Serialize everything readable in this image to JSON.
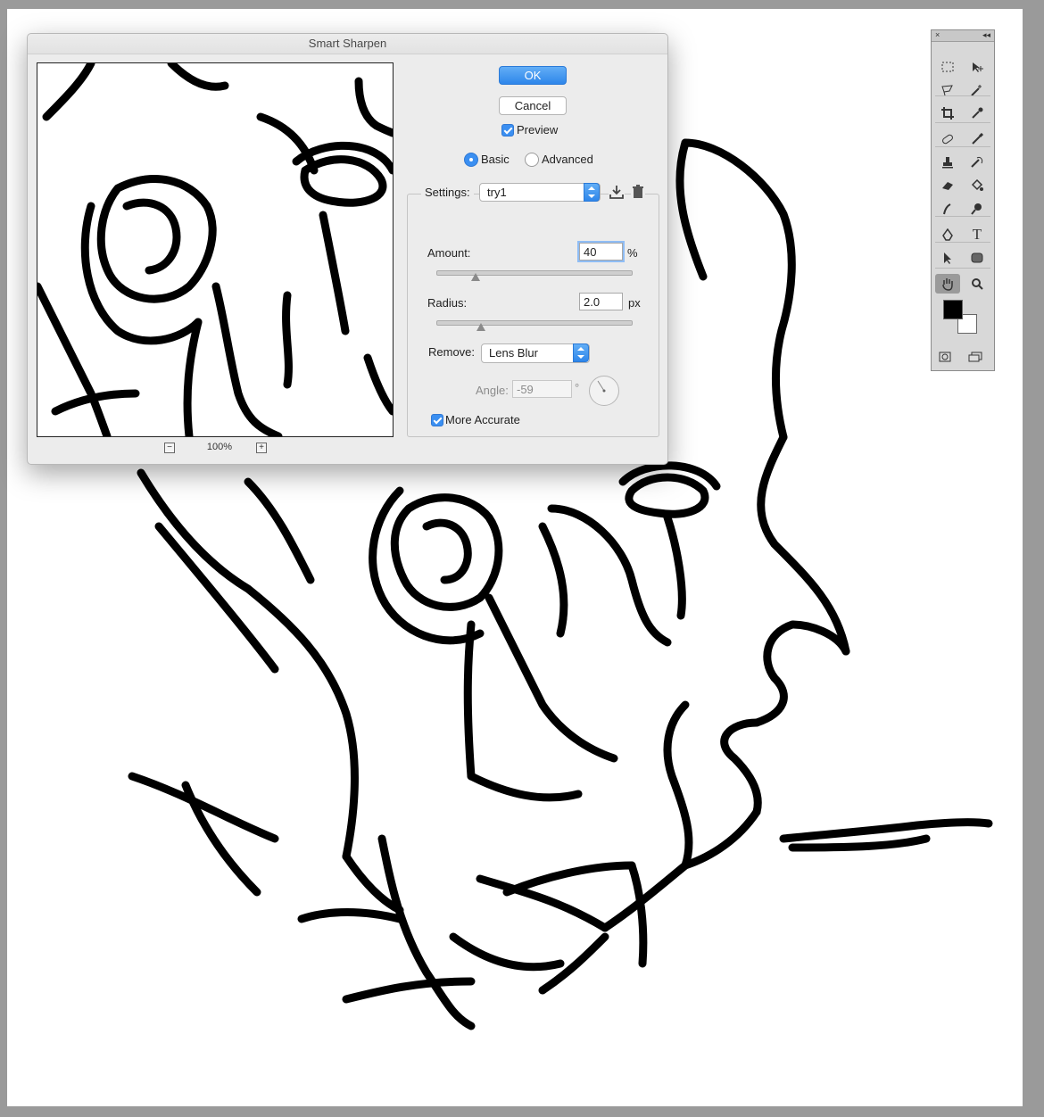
{
  "dialog": {
    "title": "Smart Sharpen",
    "ok_label": "OK",
    "cancel_label": "Cancel",
    "preview_label": "Preview",
    "preview_checked": true,
    "mode_basic_label": "Basic",
    "mode_advanced_label": "Advanced",
    "mode_selected": "Basic",
    "settings_label": "Settings:",
    "settings_value": "try1",
    "amount_label": "Amount:",
    "amount_value": "40",
    "amount_unit": "%",
    "amount_fraction": 0.2,
    "radius_label": "Radius:",
    "radius_value": "2.0",
    "radius_unit": "px",
    "radius_fraction": 0.23,
    "remove_label": "Remove:",
    "remove_value": "Lens Blur",
    "angle_label": "Angle:",
    "angle_value": "-59",
    "angle_unit": "°",
    "more_accurate_label": "More Accurate",
    "more_accurate_checked": true,
    "zoom_level": "100%",
    "zoom_out_label": "−",
    "zoom_in_label": "+"
  },
  "tools_panel": {
    "collapse_label": "◂◂",
    "close_label": "×",
    "tools": [
      "marquee-icon",
      "move-icon",
      "lasso-icon",
      "magic-wand-icon",
      "crop-icon",
      "eyedropper-icon",
      "healing-brush-icon",
      "brush-icon",
      "clone-stamp-icon",
      "history-brush-icon",
      "eraser-icon",
      "paint-bucket-icon",
      "smudge-icon",
      "dodge-icon",
      "pen-icon",
      "type-icon",
      "path-select-icon",
      "rectangle-icon",
      "hand-icon",
      "zoom-icon"
    ],
    "active_tool": "hand-icon",
    "type_glyph": "T",
    "foreground_color": "#000000",
    "background_color": "#ffffff"
  }
}
